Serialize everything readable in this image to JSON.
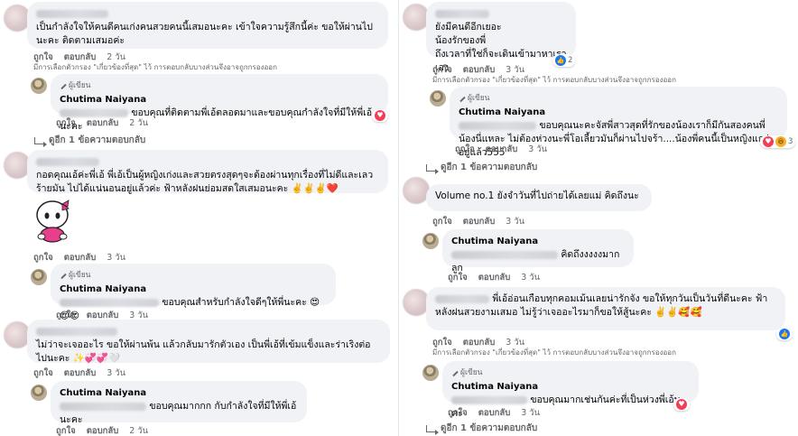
{
  "labels": {
    "like": "ถูกใจ",
    "reply": "ตอบกลับ",
    "author_badge": "ผู้เขียน",
    "filter_note": "มีการเลือกตัวกรอง \"เกี่ยวข้องที่สุด\" ไว้ การตอบกลับบางส่วนจึงอาจถูกกรองออก",
    "view_one_reply": "ดูอีก 1 ข้อความตอบกลับ"
  },
  "page_name": "Chutima Naiyana",
  "left": {
    "c1": {
      "text": "เป็นกำลังใจให้คนดีคนเก่งคนสวยคนนี้เสมอนะคะ เข้าใจความรู้สึกนี้ค่ะ ขอให้ผ่านไปนะคะ ติดตามเสมอค่ะ",
      "time": "2 วัน"
    },
    "r1": {
      "text": "ขอบคุณที่ติดตามพี่เอ้ตลอดมาและขอบคุณกำลังใจที่มีให้พี่เอ้นะคะ",
      "time": "2 วัน",
      "react_count": ""
    },
    "c2": {
      "text": "กอดคุณเอ้ค่ะพี่เอ้ พี่เอ้เป็นผู้หญิงเก่งและสวยตรงสุดๆจะต้องผ่านทุกเรื่องที่ไม่ดีและเลวร้ายมัน ไปได้แน่นอนอยู่แล้วค่ะ ฟ้าหลังฝนย่อมสดใสเสมอนะคะ ✌️✌️✌️❤️",
      "time": "3 วัน"
    },
    "r2": {
      "text": "ขอบคุณสำหรับกำลังใจดีๆให้พี่นะคะ 😍😍😍",
      "time": "3 วัน"
    },
    "c3": {
      "text": "ไม่ว่าจะเจออะไร ขอให้ผ่านพ้น แล้วกลับมารักตัวเอง เป็นพี่เอ้ที่เข้มแข็งและร่าเริงต่อไปนะคะ ✨💞💞🤍",
      "time": "3 วัน"
    },
    "r3": {
      "text": "ขอบคุณมากกก กับกำลังใจที่มีให้พี่เอ้นะคะ",
      "time": "2 วัน"
    }
  },
  "right": {
    "c1": {
      "text_lines": [
        "ยังมีคนดีอีกเยอะ",
        "น้องรักของพี่",
        "ถึงเวลาที่ใช่ก็จะเดินเข้ามาหาเราเอง"
      ],
      "time": "3 วัน",
      "react_count": "2"
    },
    "r1": {
      "text": "ขอบคุณนะคะจัสพี่สาวสุดที่รักของน้องเราก็มีกันสองคนพี่น้องนี่แหละ ไม่ต้องห่วงนะพี่โอเลี้ยวมันก็ผ่านไปจร้า....น้องพี่คนนี้เป็นหญิงแกร่งอยู่แล้ว555",
      "time": "3 วัน",
      "react_count": "3"
    },
    "c2": {
      "text": "Volume no.1 ยังจำวันที่ไปถ่ายได้เลยแม่ คิดถึงนะ",
      "time": "3 วัน"
    },
    "r2": {
      "text": "คิดถึงงงงงมากลูก",
      "time": "3 วัน"
    },
    "c3": {
      "text": "พี่เอ้อ่อนเกือบทุกคอมเม้นเลยน่ารักจัง ขอให้ทุกวันเป็นวันที่ดีนะคะ ฟ้าหลังฝนสวยงามเสมอ ไม่รู้ว่าเจออะไรมาก็ขอให้สู้นะคะ ✌️✌️🥰🥰",
      "time": "3 วัน"
    },
    "r3": {
      "text": "ขอบคุณมากเช่นกันค่ะที่เป็นห่วงพี่เอ้นะคะ",
      "time": "3 วัน"
    }
  }
}
